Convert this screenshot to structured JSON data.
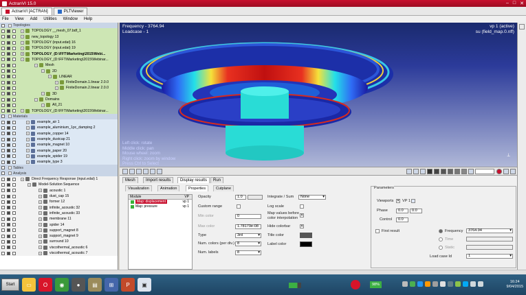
{
  "window": {
    "title": "ActranVI 15.0"
  },
  "tabs": [
    {
      "label": "ActranVI [ACTRAN]"
    },
    {
      "label": "PLTViewer"
    }
  ],
  "menu": [
    "File",
    "View",
    "Add",
    "Utilities",
    "Window",
    "Help"
  ],
  "tree": [
    {
      "text": "Topologies",
      "cls": "sec",
      "indent": 14
    },
    {
      "text": "TOPOLOGY __mesh_07.bdf_1",
      "cls": "topo",
      "indent": 32
    },
    {
      "text": "new_topology 13",
      "cls": "topo",
      "indent": 32
    },
    {
      "text": "TOPOLOGY (input.edat) 16",
      "cls": "topo",
      "indent": 32
    },
    {
      "text": "TOPOLOGY (input.edat) 19",
      "cls": "topo",
      "indent": 32
    },
    {
      "text": "TOPOLOGY_(D:\\FFT\\Marketing\\2015\\Webi...",
      "cls": "topo hl",
      "indent": 32
    },
    {
      "text": "TOPOLOGY_(D:\\FFT\\Marketing\\2015\\Webinar...",
      "cls": "topo",
      "indent": 32
    },
    {
      "text": "Mesh",
      "cls": "topo",
      "indent": 52
    },
    {
      "text": "2D",
      "cls": "topo",
      "indent": 62
    },
    {
      "text": "LINEAR",
      "cls": "topo",
      "indent": 72
    },
    {
      "text": "FiniteDomain.1.linear 2.0.0",
      "cls": "topo",
      "indent": 82
    },
    {
      "text": "FiniteDomain.2.linear 2.0.0",
      "cls": "topo",
      "indent": 82
    },
    {
      "text": "3D",
      "cls": "topo",
      "indent": 62
    },
    {
      "text": "Domains",
      "cls": "topo",
      "indent": 52
    },
    {
      "text": "All_21",
      "cls": "topo",
      "indent": 62
    },
    {
      "text": "TOPOLOGY_(D:\\FFT\\Marketing\\2015\\Webinar...",
      "cls": "topo",
      "indent": 32
    },
    {
      "text": "Materials",
      "cls": "sec",
      "indent": 14
    },
    {
      "text": "example_air 1",
      "cls": "mat",
      "indent": 40
    },
    {
      "text": "example_aluminium_1pc_damping 2",
      "cls": "mat",
      "indent": 40
    },
    {
      "text": "example_copper 14",
      "cls": "mat",
      "indent": 40
    },
    {
      "text": "example_dustcap 21",
      "cls": "mat",
      "indent": 40
    },
    {
      "text": "example_magnet 10",
      "cls": "mat",
      "indent": 40
    },
    {
      "text": "example_paper 20",
      "cls": "mat",
      "indent": 40
    },
    {
      "text": "example_spider 19",
      "cls": "mat",
      "indent": 40
    },
    {
      "text": "example_type 3",
      "cls": "mat",
      "indent": 40
    },
    {
      "text": "Tables",
      "cls": "sec",
      "indent": 14
    },
    {
      "text": "Analysis",
      "cls": "sec",
      "indent": 14
    },
    {
      "text": "Direct Frequency Response (input.edat) 1",
      "cls": "ana",
      "indent": 32
    },
    {
      "text": "Model-Solution Sequence",
      "cls": "ana",
      "indent": 42
    },
    {
      "text": "acoustic 1",
      "cls": "ana",
      "indent": 58
    },
    {
      "text": "dust_cap 15",
      "cls": "ana",
      "indent": 58
    },
    {
      "text": "former 12",
      "cls": "ana",
      "indent": 58
    },
    {
      "text": "infinite_acoustic 32",
      "cls": "ana",
      "indent": 58
    },
    {
      "text": "infinite_acoustic 33",
      "cls": "ana",
      "indent": 58
    },
    {
      "text": "membrane 11",
      "cls": "ana",
      "indent": 58
    },
    {
      "text": "spider 14",
      "cls": "ana",
      "indent": 58
    },
    {
      "text": "support_magnet 8",
      "cls": "ana",
      "indent": 58
    },
    {
      "text": "support_magnet 9",
      "cls": "ana",
      "indent": 58
    },
    {
      "text": "surround 10",
      "cls": "ana",
      "indent": 58
    },
    {
      "text": "viscothermal_acoustic 6",
      "cls": "ana",
      "indent": 58
    },
    {
      "text": "viscothermal_acoustic 7",
      "cls": "ana",
      "indent": 58
    }
  ],
  "viewport": {
    "frequency": "Frequency - 3764.94",
    "loadcase": "Loadcase - 1",
    "vp": "vp 1 (active)",
    "field": "su (field_map.0.nff)",
    "help": [
      "Left click: rotate",
      "Middle click: pan",
      "Mouse wheel: zoom",
      "Right click: zoom by window",
      "Press Ctrl to Select"
    ]
  },
  "panel": {
    "tabs": [
      "Mesh",
      "Import results",
      "Display results",
      "Run"
    ],
    "subtabs": [
      "Visualization",
      "Animation",
      "Properties",
      "Cutplane"
    ],
    "module": {
      "header": "Module",
      "header2": "VP",
      "rows": [
        {
          "name": "Map: displacement",
          "vp": "vp 1"
        },
        {
          "name": "Map: pressure",
          "vp": "vp 1"
        }
      ]
    },
    "opacity_label": "Opacity",
    "opacity": "1.0",
    "custom_range": "Custom range",
    "min_color_label": "Min color",
    "min_color": "0",
    "max_color_label": "Max color",
    "max_color": "1.78179e-08",
    "type_label": "Type",
    "type": "3rd",
    "numcolors_label": "Num. colors (per div.)",
    "numcolors": "8",
    "numlabels_label": "Num. labels",
    "numlabels": "8",
    "integrate_label": "Integrate / Sum",
    "integrate": "None",
    "logscale": "Log scale",
    "mapvalues": [
      "Map values before",
      "color interpolation"
    ],
    "hidecolorbar": "Hide colorbar",
    "titlecolor": "Title color",
    "labelcolor": "Label color",
    "parameters": "Parameters",
    "viewports_label": "Viewports",
    "vp1": "VP 1",
    "phase_label": "Phase",
    "phase_a": "0.0",
    "phase_b": "0.0",
    "control_label": "Control",
    "control": "0.0",
    "firstresult": "First result",
    "freq_label": "Frequency",
    "freq": "3764.94",
    "time_label": "Time",
    "static_label": "Static",
    "loadcase_label": "Load case Id",
    "loadcase": "1"
  },
  "taskbar": {
    "start": "Start",
    "battery": "98%",
    "time": "16:24",
    "date": "9/04/2015"
  },
  "colors": {
    "accent": "#c8102e",
    "taskbar": "#2e5f82"
  }
}
